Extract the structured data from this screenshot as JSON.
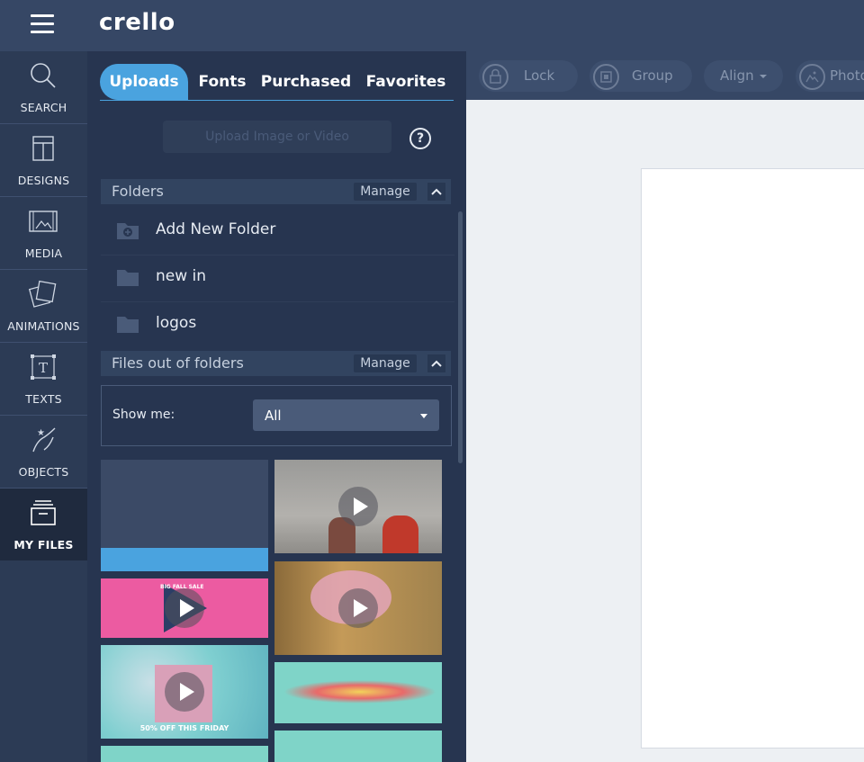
{
  "app": {
    "logo": "crello"
  },
  "nav": {
    "items": [
      {
        "label": "SEARCH",
        "icon": "search-icon"
      },
      {
        "label": "DESIGNS",
        "icon": "designs-icon"
      },
      {
        "label": "MEDIA",
        "icon": "media-icon"
      },
      {
        "label": "ANIMATIONS",
        "icon": "animations-icon"
      },
      {
        "label": "TEXTS",
        "icon": "texts-icon"
      },
      {
        "label": "OBJECTS",
        "icon": "objects-icon"
      },
      {
        "label": "MY FILES",
        "icon": "my-files-icon",
        "active": true
      }
    ]
  },
  "panel": {
    "tabs": [
      "Uploads",
      "Fonts",
      "Purchased",
      "Favorites"
    ],
    "active_tab": "Uploads",
    "upload_placeholder": "Upload Image or Video",
    "help": "?",
    "folders": {
      "title": "Folders",
      "manage": "Manage",
      "items": [
        {
          "label": "Add New Folder",
          "icon": "add-folder-icon"
        },
        {
          "label": "new in",
          "icon": "folder-icon"
        },
        {
          "label": "logos",
          "icon": "folder-icon"
        }
      ]
    },
    "files": {
      "title": "Files out of folders",
      "manage": "Manage",
      "show_me_label": "Show me:",
      "filter_value": "All"
    },
    "thumbnails": [
      {
        "kind": "image",
        "colors": [
          "#3b4a66",
          "#4aa3df"
        ]
      },
      {
        "kind": "video",
        "colors": [
          "#9b9b9b",
          "#c0392b"
        ]
      },
      {
        "kind": "video",
        "colors": [
          "#ec5ba1",
          "#2c3e66"
        ],
        "text": "BIG FALL SALE"
      },
      {
        "kind": "video",
        "colors": [
          "#b48a4d",
          "#e6a6c0"
        ]
      },
      {
        "kind": "video",
        "colors": [
          "#7fcfd0",
          "#d9a0b8"
        ],
        "text": "50% OFF THIS FRIDAY"
      },
      {
        "kind": "image",
        "colors": [
          "#7fd4c8",
          "#f2d35a"
        ]
      }
    ]
  },
  "toolbar": {
    "buttons": [
      {
        "label": "Lock",
        "icon": "lock-icon"
      },
      {
        "label": "Group",
        "icon": "group-icon"
      },
      {
        "label": "Align",
        "icon": "align-caret-icon"
      },
      {
        "label": "Photo",
        "icon": "photo-icon"
      }
    ]
  }
}
